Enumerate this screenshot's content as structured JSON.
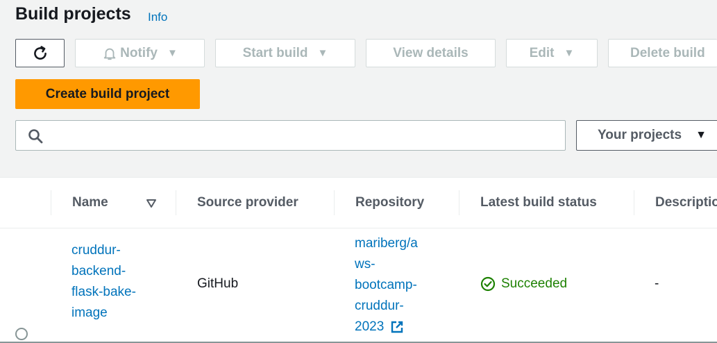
{
  "header": {
    "title": "Build projects",
    "info_label": "Info"
  },
  "toolbar": {
    "refresh_icon": "refresh-icon",
    "notify_label": "Notify",
    "start_build_label": "Start build",
    "view_details_label": "View details",
    "edit_label": "Edit",
    "delete_label": "Delete build"
  },
  "create_button_label": "Create build project",
  "search": {
    "placeholder": "",
    "value": ""
  },
  "filter": {
    "selected": "Your projects"
  },
  "table": {
    "columns": {
      "name": "Name",
      "source_provider": "Source provider",
      "repository": "Repository",
      "latest_build_status": "Latest build status",
      "description": "Descriptio"
    },
    "rows": [
      {
        "name_lines": [
          "cruddur-",
          "backend-",
          "flask-bake-",
          "image"
        ],
        "source_provider": "GitHub",
        "repository_lines": [
          "mariberg/a",
          "ws-",
          "bootcamp-",
          "cruddur-",
          "2023"
        ],
        "status": "Succeeded",
        "description": "-"
      }
    ]
  },
  "colors": {
    "accent": "#ff9900",
    "link": "#0073bb",
    "success": "#1d8102"
  }
}
